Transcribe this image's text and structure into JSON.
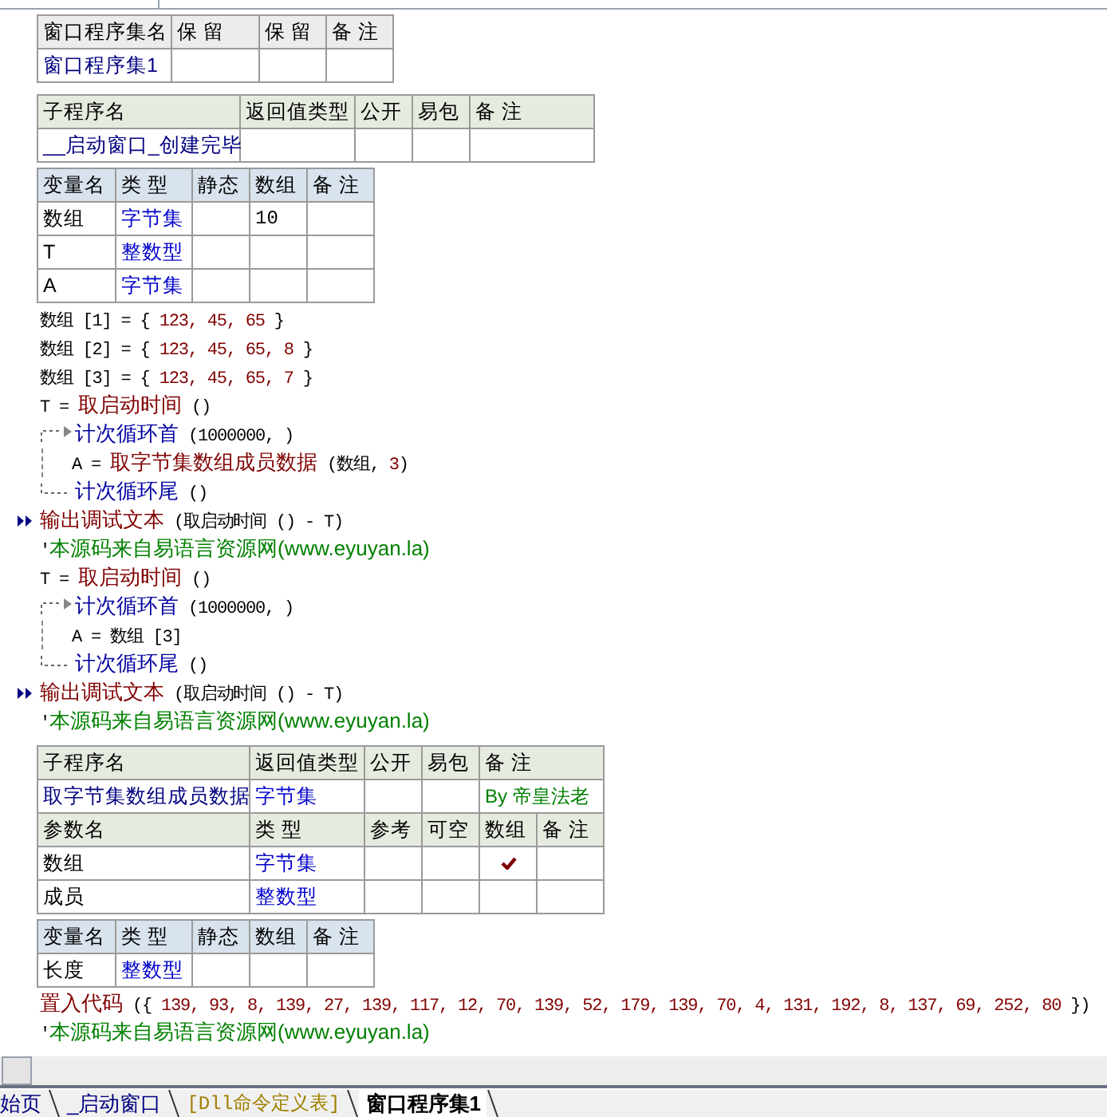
{
  "assembly_table": {
    "columns": [
      "窗口程序集名",
      "保 留",
      "保 留",
      "备 注"
    ],
    "name": "窗口程序集1"
  },
  "subroutines": [
    {
      "columns": [
        "子程序名",
        "返回值类型",
        "公开",
        "易包",
        "备 注"
      ],
      "name": "__启动窗口_创建完毕",
      "locals": {
        "columns": [
          "变量名",
          "类 型",
          "静态",
          "数组",
          "备 注"
        ],
        "rows": [
          {
            "name": "数组",
            "type": "字节集",
            "array": "10"
          },
          {
            "name": "T",
            "type": "整数型"
          },
          {
            "name": "A",
            "type": "字节集"
          }
        ]
      },
      "code": [
        {
          "kind": "stmt",
          "parts": [
            {
              "kind": "plain",
              "text": "数组 [1] = { "
            },
            {
              "kind": "num",
              "text": "123, 45, 65"
            },
            {
              "kind": "plain",
              "text": " }"
            }
          ]
        },
        {
          "kind": "stmt",
          "parts": [
            {
              "kind": "plain",
              "text": "数组 [2] = { "
            },
            {
              "kind": "num",
              "text": "123, 45, 65, 8"
            },
            {
              "kind": "plain",
              "text": " }"
            }
          ]
        },
        {
          "kind": "stmt",
          "parts": [
            {
              "kind": "plain",
              "text": "数组 [3] = { "
            },
            {
              "kind": "num",
              "text": "123, 45, 65, 7"
            },
            {
              "kind": "plain",
              "text": " }"
            }
          ]
        },
        {
          "kind": "stmt",
          "parts": [
            {
              "kind": "plain",
              "text": "T = "
            },
            {
              "kind": "func",
              "text": "取启动时间"
            },
            {
              "kind": "plain",
              "text": " ()"
            }
          ]
        },
        {
          "kind": "loop",
          "head": [
            {
              "kind": "kw",
              "text": "计次循环首"
            },
            {
              "kind": "plain",
              "text": " (1000000, )"
            }
          ],
          "children": [
            {
              "kind": "stmt",
              "parts": [
                {
                  "kind": "plain",
                  "text": "A = "
                },
                {
                  "kind": "func",
                  "text": "取字节集数组成员数据"
                },
                {
                  "kind": "plain",
                  "text": " (数组, "
                },
                {
                  "kind": "num",
                  "text": "3"
                },
                {
                  "kind": "plain",
                  "text": ")"
                }
              ]
            }
          ],
          "tail": [
            {
              "kind": "kw",
              "text": "计次循环尾"
            },
            {
              "kind": "plain",
              "text": " ()"
            }
          ]
        },
        {
          "kind": "debug",
          "parts": [
            {
              "kind": "func",
              "text": "输出调试文本"
            },
            {
              "kind": "plain",
              "text": " (取启动时间 () - T)"
            }
          ]
        },
        {
          "kind": "comment",
          "parts": [
            {
              "kind": "plain",
              "text": "'"
            },
            {
              "kind": "comment",
              "text": "本源码来自易语言资源网(www.eyuyan.la)"
            }
          ]
        },
        {
          "kind": "stmt",
          "parts": [
            {
              "kind": "plain",
              "text": "T = "
            },
            {
              "kind": "func",
              "text": "取启动时间"
            },
            {
              "kind": "plain",
              "text": " ()"
            }
          ]
        },
        {
          "kind": "loop",
          "head": [
            {
              "kind": "kw",
              "text": "计次循环首"
            },
            {
              "kind": "plain",
              "text": " (1000000, )"
            }
          ],
          "children": [
            {
              "kind": "stmt",
              "parts": [
                {
                  "kind": "plain",
                  "text": "A = 数组 [3]"
                }
              ]
            }
          ],
          "tail": [
            {
              "kind": "kw",
              "text": "计次循环尾"
            },
            {
              "kind": "plain",
              "text": " ()"
            }
          ]
        },
        {
          "kind": "debug",
          "parts": [
            {
              "kind": "func",
              "text": "输出调试文本"
            },
            {
              "kind": "plain",
              "text": " (取启动时间 () - T)"
            }
          ]
        },
        {
          "kind": "comment",
          "parts": [
            {
              "kind": "plain",
              "text": "'"
            },
            {
              "kind": "comment",
              "text": "本源码来自易语言资源网(www.eyuyan.la)"
            }
          ]
        }
      ]
    },
    {
      "columns": [
        "子程序名",
        "返回值类型",
        "公开",
        "易包",
        "备 注"
      ],
      "name": "取字节集数组成员数据",
      "return_type": "字节集",
      "note": "By 帝皇法老",
      "params": {
        "columns": [
          "参数名",
          "类 型",
          "参考",
          "可空",
          "数组",
          "备 注"
        ],
        "rows": [
          {
            "name": "数组",
            "type": "字节集",
            "array": true
          },
          {
            "name": "成员",
            "type": "整数型",
            "array": false
          }
        ]
      },
      "locals": {
        "columns": [
          "变量名",
          "类 型",
          "静态",
          "数组",
          "备 注"
        ],
        "rows": [
          {
            "name": "长度",
            "type": "整数型"
          }
        ]
      },
      "code": [
        {
          "kind": "stmt",
          "parts": [
            {
              "kind": "func",
              "text": "置入代码"
            },
            {
              "kind": "plain",
              "text": " ({ "
            },
            {
              "kind": "num",
              "text": "139, 93, 8, 139, 27, 139, 117, 12, 70, 139, 52, 179, 139, 70, 4, 131, 192, 8, 137, 69, 252, 80"
            },
            {
              "kind": "plain",
              "text": " })"
            }
          ]
        },
        {
          "kind": "comment",
          "parts": [
            {
              "kind": "plain",
              "text": "'"
            },
            {
              "kind": "comment",
              "text": "本源码来自易语言资源网(www.eyuyan.la)"
            }
          ]
        }
      ]
    }
  ],
  "tabs": [
    {
      "label": "始页",
      "kind": "page",
      "selected": false
    },
    {
      "label": "_启动窗口",
      "kind": "page",
      "selected": false
    },
    {
      "label": "[Dll命令定义表]",
      "kind": "dll",
      "selected": false
    },
    {
      "label": "窗口程序集1",
      "kind": "page",
      "selected": true
    }
  ]
}
